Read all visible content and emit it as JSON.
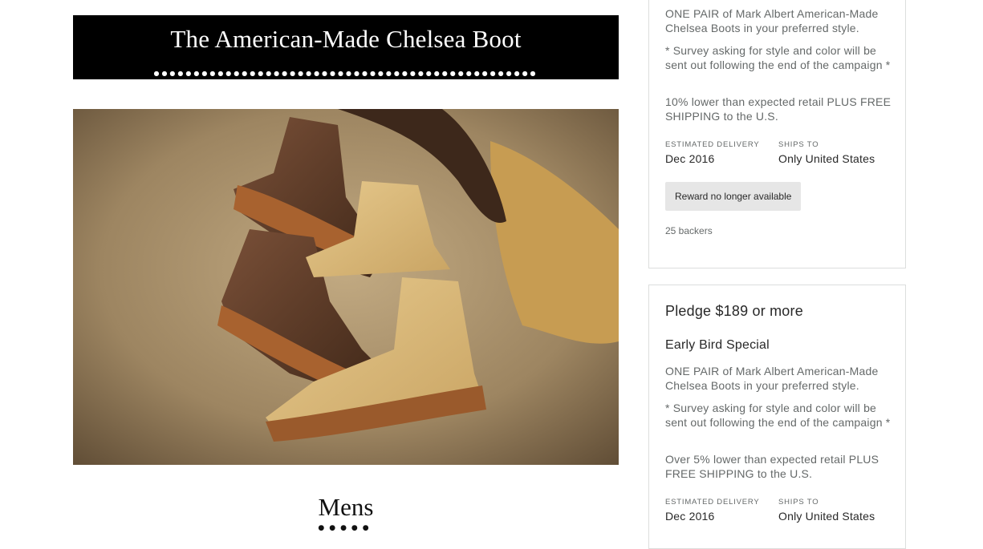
{
  "banner": {
    "title": "The American-Made Chelsea Boot",
    "dots": "●●●●●●●●●●●●●●●●●●●●●●●●●●●●●●●●●●●●●●●●●●●●●●●●"
  },
  "photo": {
    "alt": "product-photo-chelsea-boots"
  },
  "section": {
    "title": "Mens",
    "dots": "●●●●●"
  },
  "reward1": {
    "description": "ONE PAIR of Mark Albert American-Made Chelsea Boots in your preferred style.",
    "survey": "* Survey asking for style and color will be sent out following the end of the campaign *",
    "discount": "10% lower than expected retail PLUS FREE SHIPPING to the U.S.",
    "delivery_label": "ESTIMATED DELIVERY",
    "delivery_value": "Dec 2016",
    "ships_label": "SHIPS TO",
    "ships_value": "Only United States",
    "button_label": "Reward no longer available",
    "backers": "25 backers"
  },
  "reward2": {
    "pledge": "Pledge $189 or more",
    "title": "Early Bird Special",
    "description": "ONE PAIR of Mark Albert American-Made Chelsea Boots in your preferred style.",
    "survey": "* Survey asking for style and color will be sent out following the end of the campaign *",
    "discount": "Over 5% lower than expected retail PLUS FREE SHIPPING to the U.S.",
    "delivery_label": "ESTIMATED DELIVERY",
    "delivery_value": "Dec 2016",
    "ships_label": "SHIPS TO",
    "ships_value": "Only United States"
  }
}
